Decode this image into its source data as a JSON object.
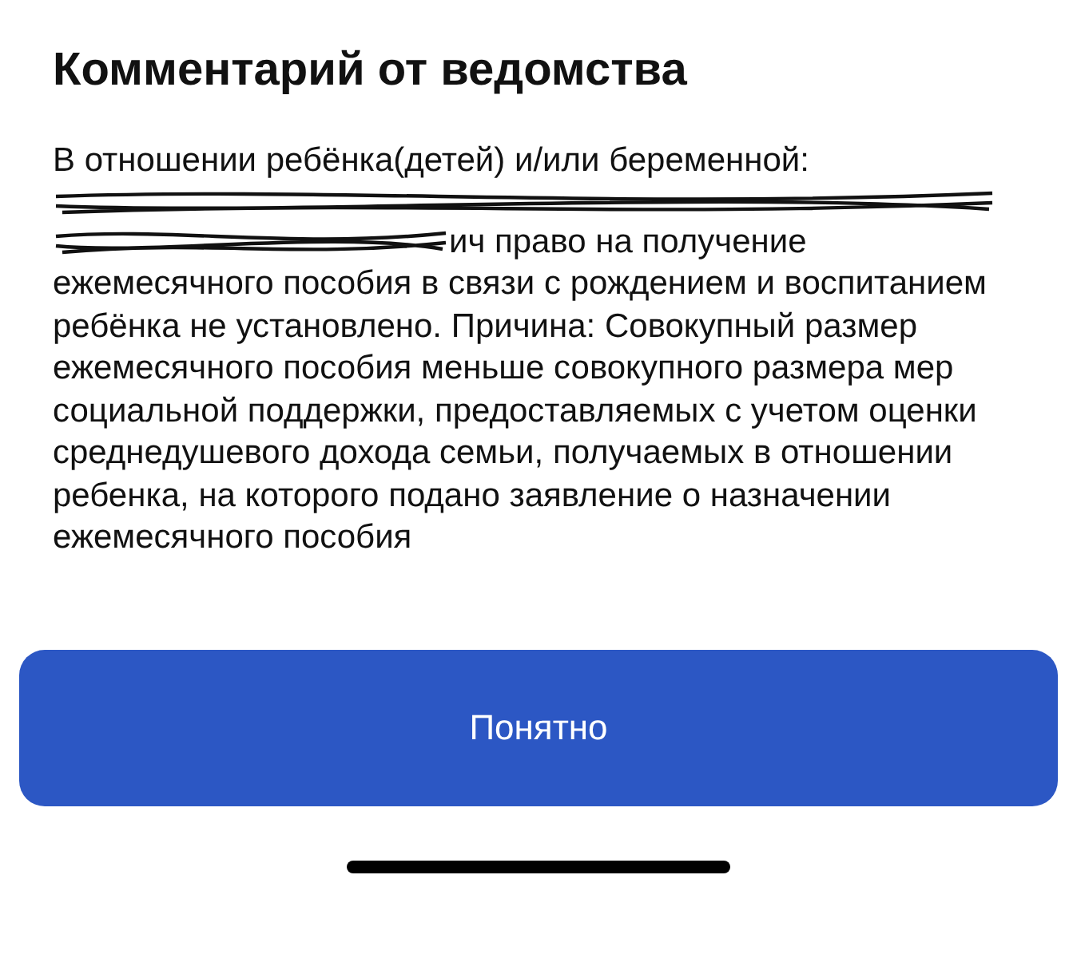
{
  "title": "Комментарий от ведомства",
  "comment": {
    "intro": "В отношении ребёнка(детей) и/или беременной:",
    "after_redaction": "ич право на получение",
    "rest": "ежемесячного пособия в связи с рождением и воспитанием ребёнка не установлено. Причина: Совокупный размер ежемесячного пособия меньше совокупного размера мер социальной поддержки, предоставляемых с учетом оценки среднедушевого дохода семьи, получаемых в отношении ребенка, на которого подано заявление о назначении ежемесячного пособия"
  },
  "button": {
    "label": "Понятно"
  }
}
